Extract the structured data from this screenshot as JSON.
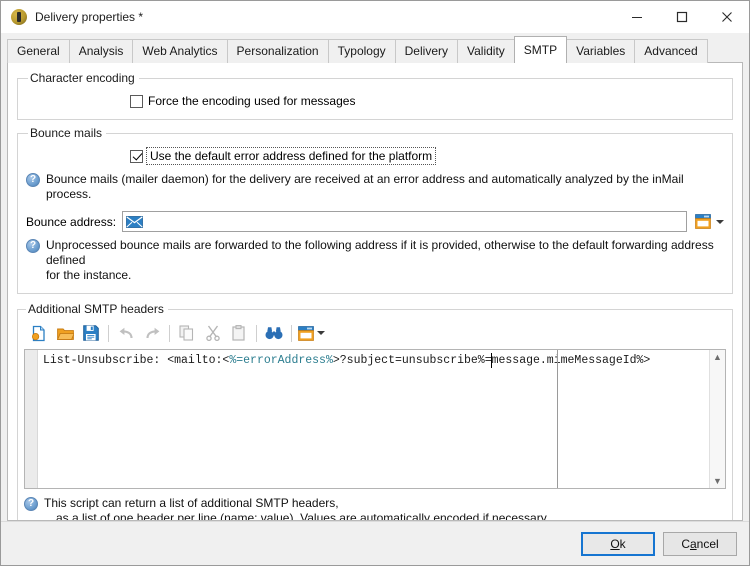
{
  "window": {
    "title": "Delivery properties *",
    "icon": "app-icon",
    "controls": {
      "minimize": "minimize-icon",
      "maximize": "maximize-icon",
      "close": "close-icon"
    }
  },
  "tabs": [
    {
      "label": "General",
      "active": false
    },
    {
      "label": "Analysis",
      "active": false
    },
    {
      "label": "Web Analytics",
      "active": false
    },
    {
      "label": "Personalization",
      "active": false
    },
    {
      "label": "Typology",
      "active": false
    },
    {
      "label": "Delivery",
      "active": false
    },
    {
      "label": "Validity",
      "active": false
    },
    {
      "label": "SMTP",
      "active": true
    },
    {
      "label": "Variables",
      "active": false
    },
    {
      "label": "Advanced",
      "active": false
    }
  ],
  "character_encoding": {
    "legend": "Character encoding",
    "force_encoding": {
      "label": "Force the encoding used for messages",
      "checked": false
    }
  },
  "bounce_mails": {
    "legend": "Bounce mails",
    "use_default_error_address": {
      "label": "Use the default error address defined for the platform",
      "checked": true,
      "focused": true
    },
    "help_1": "Bounce mails (mailer daemon) for the delivery are received at an error address and automatically analyzed by the inMail process.",
    "address_label": "Bounce address:",
    "address_value": "",
    "address_placeholder": "",
    "address_icon": "envelope-icon",
    "address_picker_icon": "form-window-icon",
    "help_2_line1": "Unprocessed bounce mails are forwarded to the following address if it is provided, otherwise to the default forwarding address defined",
    "help_2_line2": "for the instance."
  },
  "smtp_headers": {
    "legend": "Additional SMTP headers",
    "toolbar": [
      {
        "name": "new-script-icon",
        "title": "New"
      },
      {
        "name": "open-folder-icon",
        "title": "Open"
      },
      {
        "name": "save-icon",
        "title": "Save"
      },
      {
        "name": "undo-icon",
        "title": "Undo"
      },
      {
        "name": "redo-icon",
        "title": "Redo"
      },
      {
        "name": "copy-icon",
        "title": "Copy"
      },
      {
        "name": "cut-icon",
        "title": "Cut"
      },
      {
        "name": "paste-icon",
        "title": "Paste"
      },
      {
        "name": "find-binoculars-icon",
        "title": "Find"
      },
      {
        "name": "insert-field-icon",
        "title": "Insert"
      }
    ],
    "code": {
      "prefix": "List-Unsubscribe: <mailto:<",
      "highlight": "%=errorAddress%",
      "suffix": ">?subject=unsubscribe%=message.mimeMessageId%>",
      "full": "List-Unsubscribe: <mailto:<%=errorAddress%>?subject=unsubscribe%=message.mimeMessageId%>"
    },
    "scroll": {
      "up": "▲",
      "down": "▼"
    },
    "help_line1": "This script can return a list of additional SMTP headers,",
    "help_line2": "as a list of one header per line (name: value). Values are automatically encoded if necessary."
  },
  "footer": {
    "ok": {
      "pre": "",
      "mnemonic": "O",
      "post": "k",
      "default": true
    },
    "cancel": {
      "pre": "C",
      "mnemonic": "a",
      "post": "ncel",
      "default": false
    }
  },
  "colors": {
    "accent": "#1675d1",
    "highlight": "#2b7d8f",
    "orange": "#f0a020",
    "blue": "#2b7fc4",
    "window_bg": "#f0f0f0",
    "panel_bg": "#ffffff"
  }
}
